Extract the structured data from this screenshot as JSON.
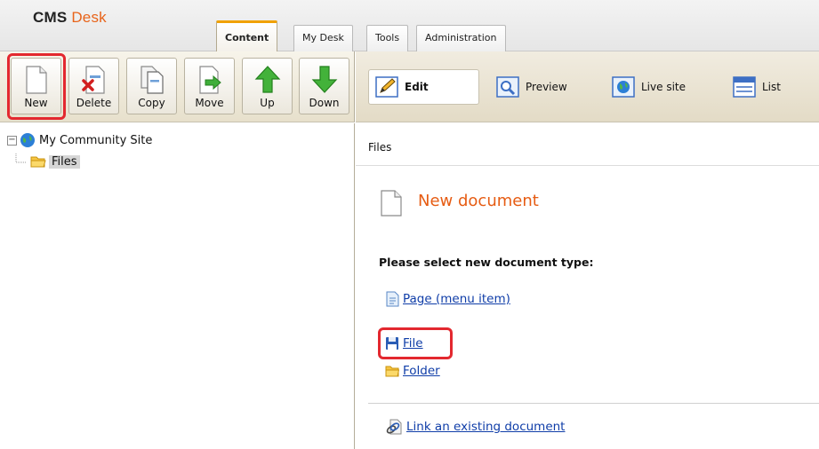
{
  "header": {
    "logo_cms": "CMS",
    "logo_desk": "Desk",
    "tabs": [
      {
        "label": "Content",
        "active": true
      },
      {
        "label": "My Desk",
        "active": false
      },
      {
        "label": "Tools",
        "active": false
      },
      {
        "label": "Administration",
        "active": false
      }
    ]
  },
  "tree_toolbar": {
    "buttons": [
      {
        "label": "New",
        "icon": "new-page-icon",
        "highlighted": true
      },
      {
        "label": "Delete",
        "icon": "delete-page-icon"
      },
      {
        "label": "Copy",
        "icon": "copy-page-icon"
      },
      {
        "label": "Move",
        "icon": "move-page-icon"
      },
      {
        "label": "Up",
        "icon": "arrow-up-icon"
      },
      {
        "label": "Down",
        "icon": "arrow-down-icon"
      }
    ]
  },
  "view_toolbar": {
    "modes": [
      {
        "label": "Edit",
        "icon": "pencil-icon",
        "selected": true
      },
      {
        "label": "Preview",
        "icon": "magnifier-icon"
      },
      {
        "label": "Live site",
        "icon": "globe-icon"
      },
      {
        "label": "List",
        "icon": "list-icon"
      }
    ]
  },
  "tree": {
    "root": {
      "label": "My Community Site",
      "expander": "−",
      "icon": "globe-icon"
    },
    "children": [
      {
        "label": "Files",
        "icon": "folder-icon",
        "selected": true
      }
    ]
  },
  "breadcrumb": "Files",
  "content": {
    "title": "New document",
    "instruction": "Please select new document type:",
    "document_types": [
      {
        "label": "Page (menu item)",
        "icon": "page-icon"
      },
      {
        "label": "File",
        "icon": "floppy-disk-icon",
        "highlighted": true
      },
      {
        "label": "Folder",
        "icon": "folder-icon"
      }
    ],
    "link_existing": {
      "label": "Link an existing document",
      "icon": "link-document-icon"
    }
  },
  "colors": {
    "accent_orange": "#e65c13",
    "link_blue": "#0f3da8",
    "highlight_red": "#e3282f",
    "active_tab_top": "#f0a100"
  }
}
